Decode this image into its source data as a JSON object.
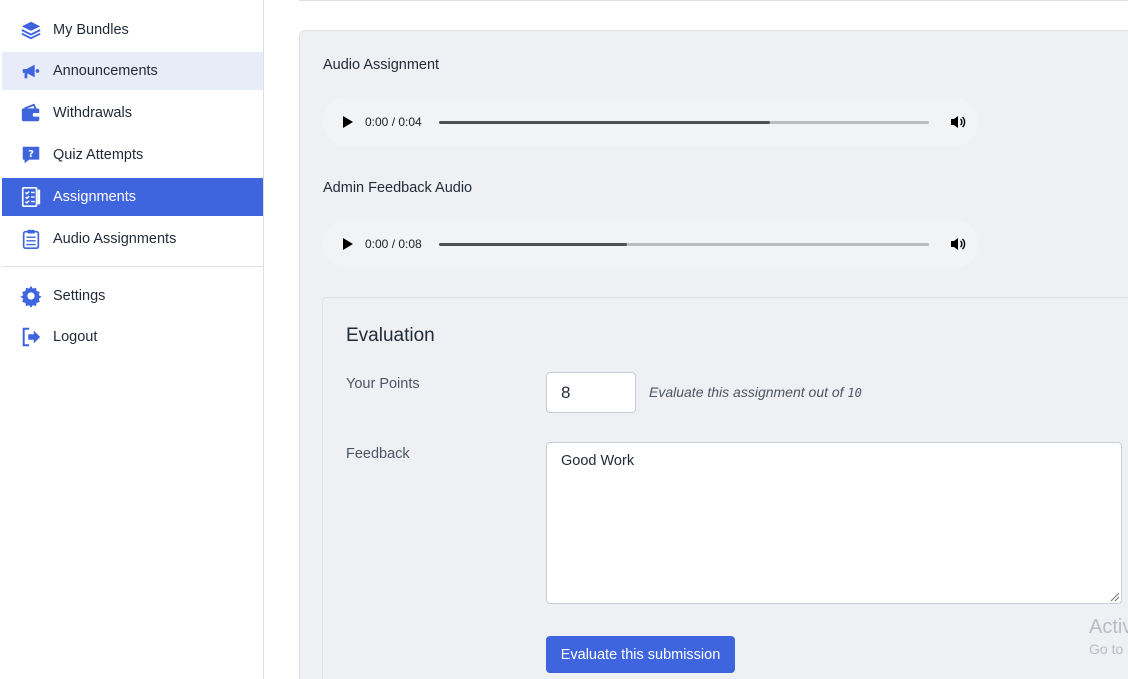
{
  "sidebar": {
    "items": [
      {
        "label": "My Bundles",
        "icon": "layers-icon"
      },
      {
        "label": "Announcements",
        "icon": "megaphone-icon"
      },
      {
        "label": "Withdrawals",
        "icon": "wallet-icon"
      },
      {
        "label": "Quiz Attempts",
        "icon": "question-icon"
      },
      {
        "label": "Assignments",
        "icon": "checklist-icon"
      },
      {
        "label": "Audio Assignments",
        "icon": "clipboard-icon"
      },
      {
        "label": "Settings",
        "icon": "gear-icon"
      },
      {
        "label": "Logout",
        "icon": "logout-icon"
      }
    ],
    "active_item": "Assignments",
    "hovered_item": "Announcements"
  },
  "main": {
    "audio_assignment": {
      "label": "Audio Assignment",
      "time": "0:00 / 0:04",
      "progress": 0.675
    },
    "admin_feedback_audio": {
      "label": "Admin Feedback Audio",
      "time": "0:00 / 0:08",
      "progress": 0.384
    },
    "evaluation": {
      "title": "Evaluation",
      "points_label": "Your Points",
      "points_value": "8",
      "hint_text": "Evaluate this assignment out of",
      "hint_max": "10",
      "feedback_label": "Feedback",
      "feedback_value": "Good Work",
      "submit_label": "Evaluate this submission"
    },
    "watermark": {
      "line1": "Activ",
      "line2": "Go to"
    }
  },
  "colors": {
    "accent": "#3e64de",
    "hover_bg": "#e8ecf8",
    "panel_bg": "#eff0f4"
  }
}
